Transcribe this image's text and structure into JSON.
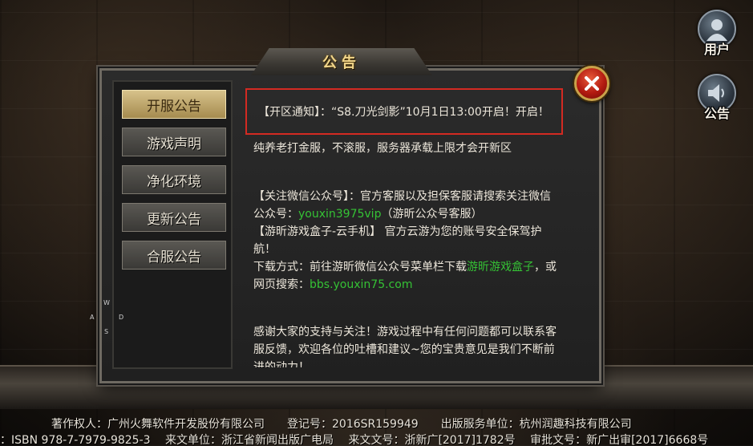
{
  "header": {
    "user_label": "用户",
    "notice_label": "公告"
  },
  "dialog": {
    "title": "公告",
    "tabs": [
      "开服公告",
      "游戏声明",
      "净化环境",
      "更新公告",
      "合服公告"
    ],
    "active_tab": 0,
    "content": {
      "notice_line": "【开区通知】：“S8.刀光剑影”10月1日13:00开启！开启！",
      "line2": "纯养老打金服，不滚服，服务器承载上限才会开新区",
      "wechat_l1": "【关注微信公众号】：官方客服以及担保客服请搜索关注微信",
      "wechat_l2_prefix": "公众号：",
      "wechat_id": "youxin3975vip",
      "wechat_l2_suffix": "（游昕公众号客服）",
      "box_l1": "【游昕游戏盒子-云手机】 官方云游为您的账号安全保驾护",
      "box_l2": "航！",
      "download_l1_prefix": "下载方式：前往游昕微信公众号菜单栏下载",
      "download_link": "游昕游戏盒子",
      "download_l1_suffix": "，或",
      "download_l2_prefix": "网页搜索：",
      "site": "bbs.youxin75.com",
      "thanks_l1": "感谢大家的支持与关注！游戏过程中有任何问题都可以联系客",
      "thanks_l2": "服反馈，欢迎各位的吐槽和建议~您的宝贵意见是我们不断前",
      "thanks_l3": "进的动力！"
    }
  },
  "wasd": {
    "w": "W",
    "a": "A",
    "s": "S",
    "d": "D"
  },
  "footer": {
    "line1": "著作权人：广州火舞软件开发股份有限公司　　登记号：2016SR159949　　出版服务单位：杭州润趣科技有限公司",
    "line2": "：ISBN 978-7-7979-9825-3　 来文单位：浙江省新闻出版广电局　 来文文号：浙新广[2017]1782号　 审批文号：新广出审[2017]6668号"
  },
  "colors": {
    "notice_border": "#d32a22",
    "link_green": "#35c235",
    "title_gold": "#f1d58a"
  }
}
